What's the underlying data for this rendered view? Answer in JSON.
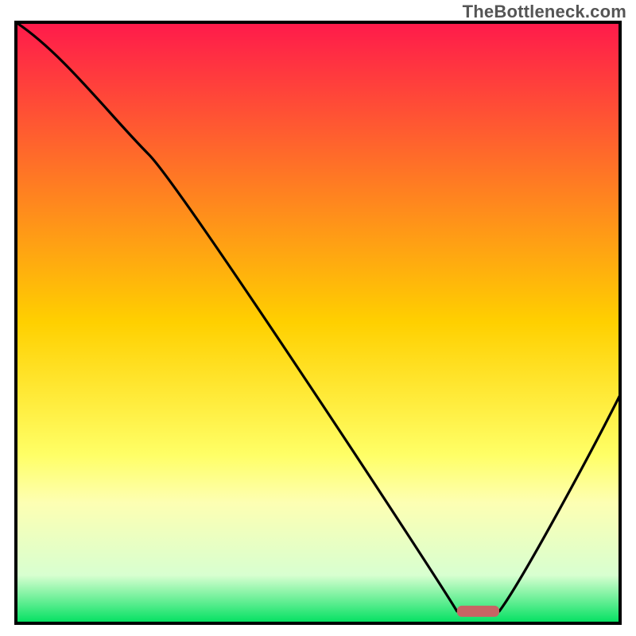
{
  "watermark": "TheBottleneck.com",
  "chart_data": {
    "type": "line",
    "title": "",
    "xlabel": "",
    "ylabel": "",
    "xlim": [
      0,
      100
    ],
    "ylim": [
      0,
      100
    ],
    "x": [
      0,
      22,
      73,
      80,
      100
    ],
    "values": [
      100,
      78,
      2,
      2,
      38
    ],
    "optimum_band": {
      "x_start": 73,
      "x_end": 80,
      "y": 2
    },
    "gradient_stops": [
      {
        "offset": 0.0,
        "color": "#ff1a4b"
      },
      {
        "offset": 0.5,
        "color": "#ffd000"
      },
      {
        "offset": 0.72,
        "color": "#ffff66"
      },
      {
        "offset": 0.8,
        "color": "#fdffb3"
      },
      {
        "offset": 0.92,
        "color": "#d8ffd0"
      },
      {
        "offset": 1.0,
        "color": "#00e060"
      }
    ],
    "marker": {
      "color": "#c86464",
      "x": 76.5,
      "width_pct": 7
    }
  },
  "frame": {
    "stroke": "#000000",
    "stroke_width": 4,
    "inner_x": 20,
    "inner_y": 28,
    "inner_w": 760,
    "inner_h": 756
  }
}
